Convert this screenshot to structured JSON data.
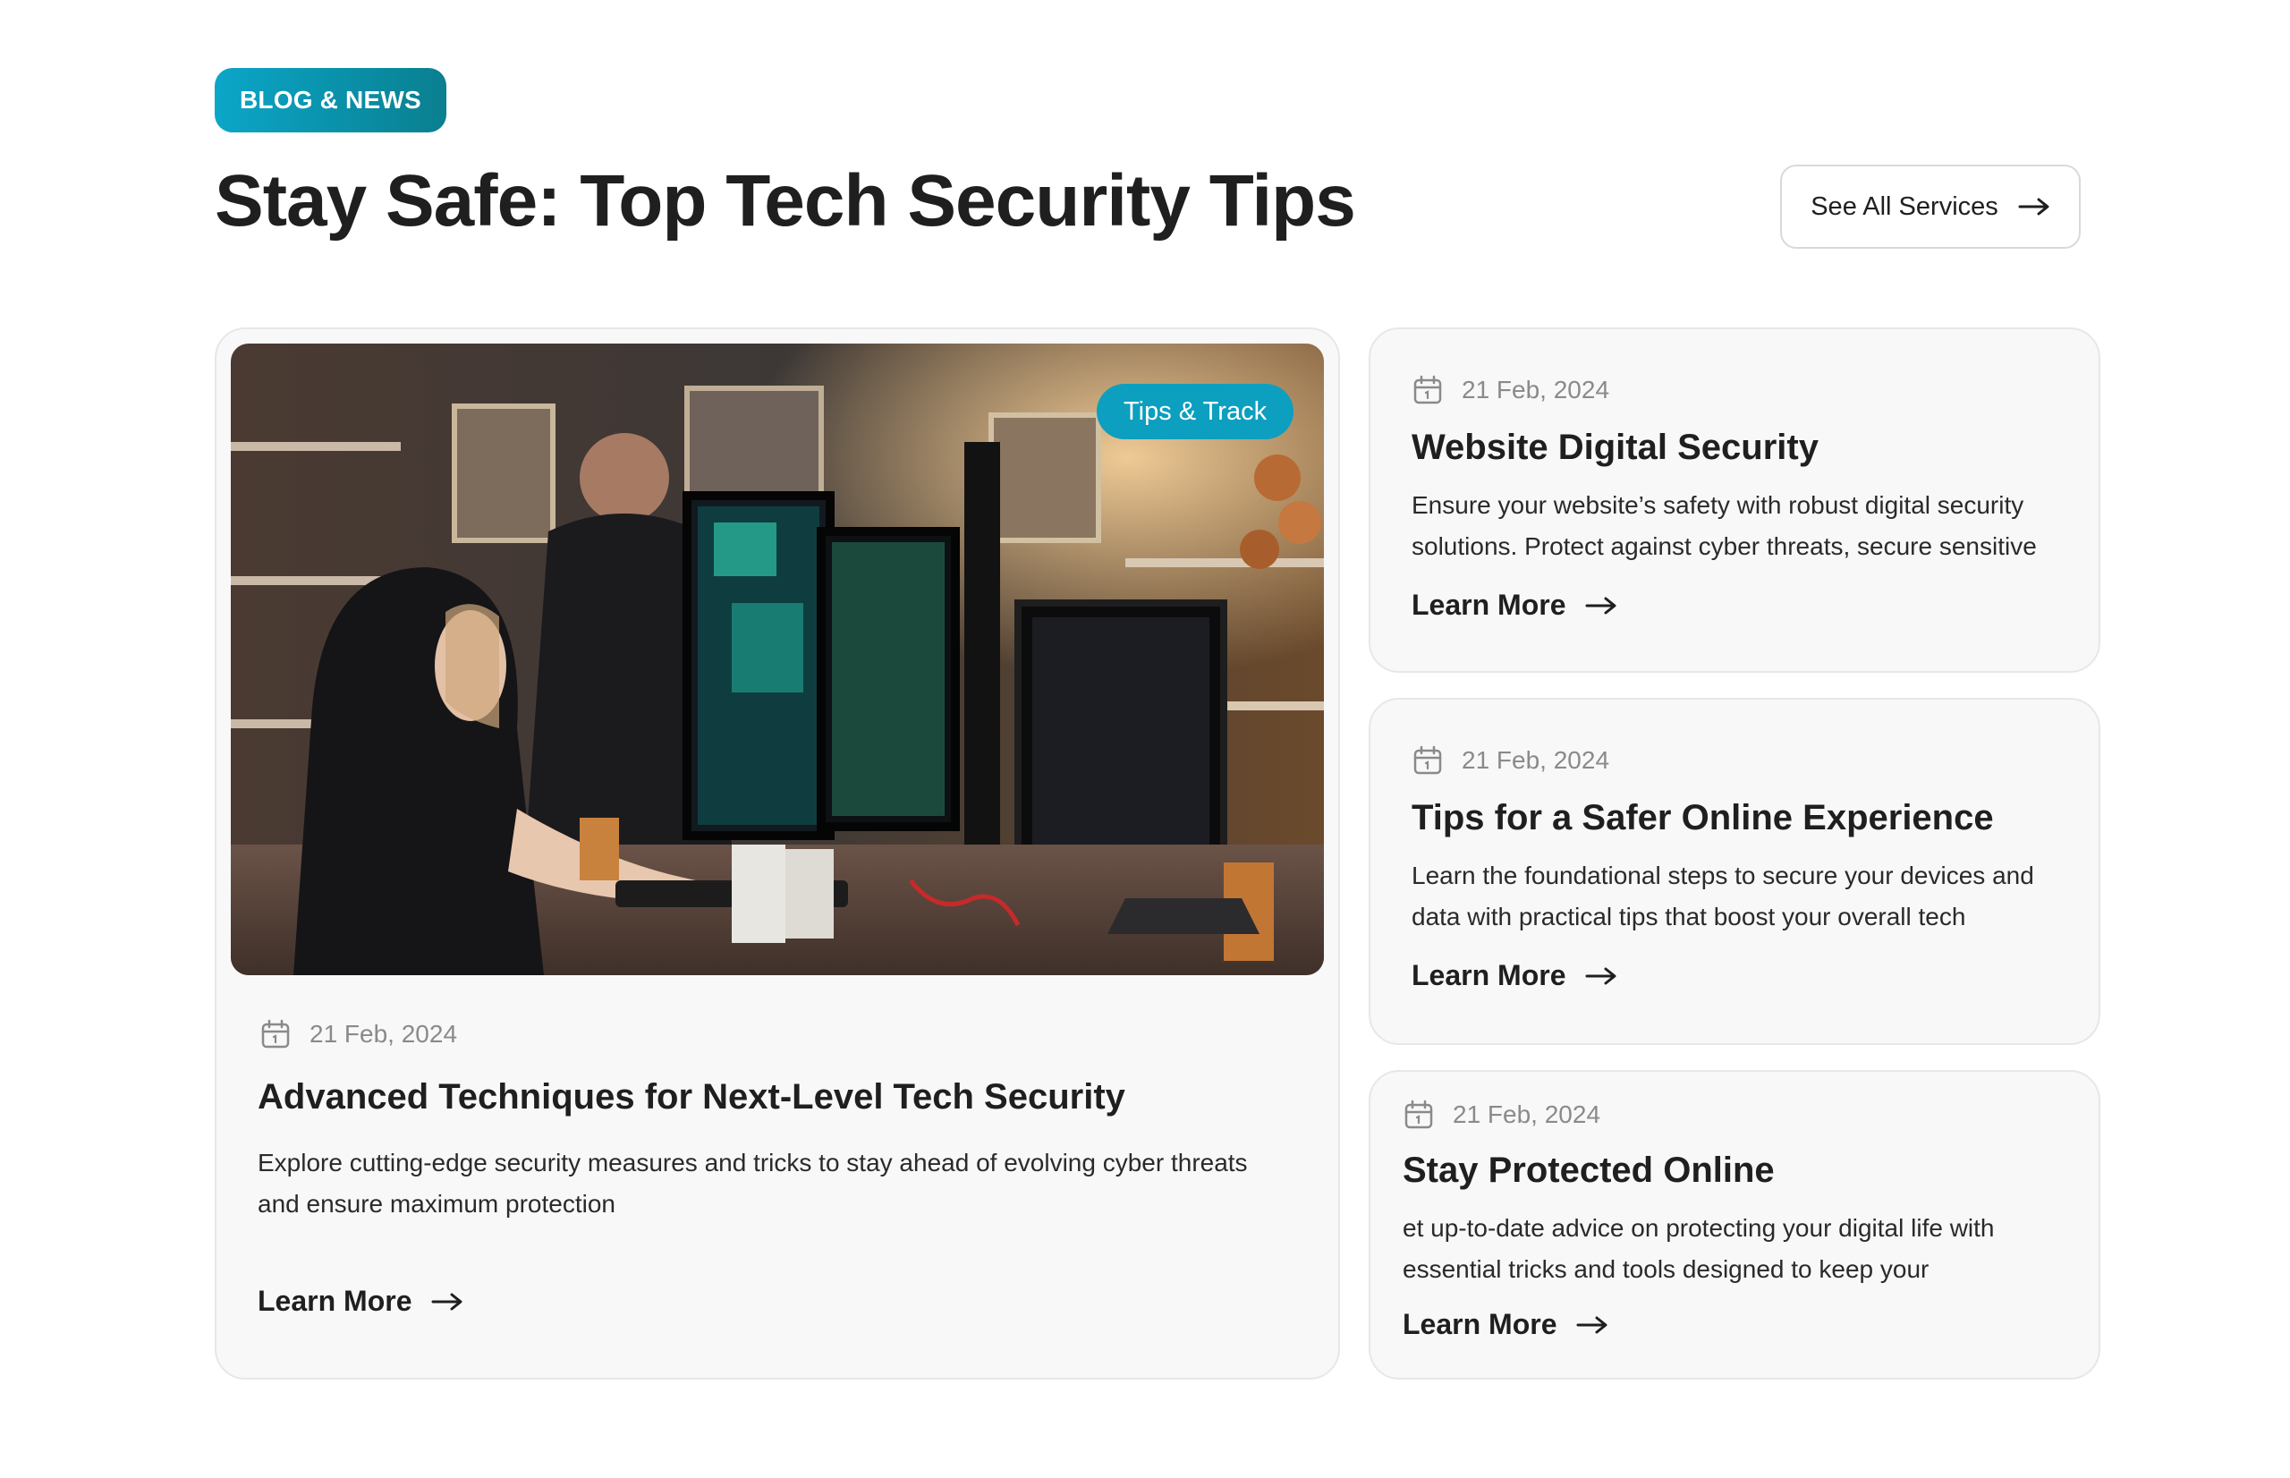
{
  "header": {
    "badge": "BLOG & NEWS",
    "title": "Stay Safe: Top Tech Security Tips",
    "see_all_label": "See All Services"
  },
  "featured": {
    "tag": "Tips & Track",
    "date": "21 Feb, 2024",
    "title": "Advanced Techniques for Next-Level Tech Security",
    "description": "Explore cutting-edge security measures and tricks to stay ahead of evolving cyber threats and ensure maximum protection",
    "link": "Learn More"
  },
  "posts": [
    {
      "date": "21 Feb, 2024",
      "title": "Website Digital Security",
      "description": "Ensure your website’s safety with robust digital security solutions. Protect against cyber threats, secure sensitive",
      "link": "Learn More"
    },
    {
      "date": "21 Feb, 2024",
      "title": "Tips for a Safer Online Experience",
      "description": "Learn the foundational steps to secure your devices and data with practical tips that boost your overall tech",
      "link": "Learn More"
    },
    {
      "date": "21 Feb, 2024",
      "title": "Stay Protected Online",
      "description": "et up-to-date advice on protecting your digital life with essential tricks and tools designed to keep your",
      "link": "Learn More"
    }
  ],
  "colors": {
    "accent_start": "#0ba6c9",
    "accent_end": "#0a7f8f",
    "text_dark": "#1f1f1f",
    "text_muted": "#8a8a8a"
  },
  "icons": {
    "date": "calendar-icon",
    "link": "arrow-right-icon"
  }
}
